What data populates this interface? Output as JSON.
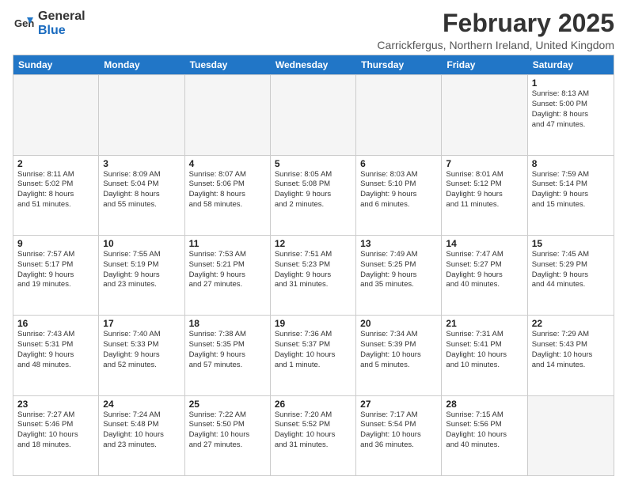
{
  "logo": {
    "general": "General",
    "blue": "Blue"
  },
  "title": "February 2025",
  "location": "Carrickfergus, Northern Ireland, United Kingdom",
  "days": [
    "Sunday",
    "Monday",
    "Tuesday",
    "Wednesday",
    "Thursday",
    "Friday",
    "Saturday"
  ],
  "weeks": [
    [
      {
        "num": "",
        "info": "",
        "empty": true
      },
      {
        "num": "",
        "info": "",
        "empty": true
      },
      {
        "num": "",
        "info": "",
        "empty": true
      },
      {
        "num": "",
        "info": "",
        "empty": true
      },
      {
        "num": "",
        "info": "",
        "empty": true
      },
      {
        "num": "",
        "info": "",
        "empty": true
      },
      {
        "num": "1",
        "info": "Sunrise: 8:13 AM\nSunset: 5:00 PM\nDaylight: 8 hours\nand 47 minutes.",
        "empty": false
      }
    ],
    [
      {
        "num": "2",
        "info": "Sunrise: 8:11 AM\nSunset: 5:02 PM\nDaylight: 8 hours\nand 51 minutes.",
        "empty": false
      },
      {
        "num": "3",
        "info": "Sunrise: 8:09 AM\nSunset: 5:04 PM\nDaylight: 8 hours\nand 55 minutes.",
        "empty": false
      },
      {
        "num": "4",
        "info": "Sunrise: 8:07 AM\nSunset: 5:06 PM\nDaylight: 8 hours\nand 58 minutes.",
        "empty": false
      },
      {
        "num": "5",
        "info": "Sunrise: 8:05 AM\nSunset: 5:08 PM\nDaylight: 9 hours\nand 2 minutes.",
        "empty": false
      },
      {
        "num": "6",
        "info": "Sunrise: 8:03 AM\nSunset: 5:10 PM\nDaylight: 9 hours\nand 6 minutes.",
        "empty": false
      },
      {
        "num": "7",
        "info": "Sunrise: 8:01 AM\nSunset: 5:12 PM\nDaylight: 9 hours\nand 11 minutes.",
        "empty": false
      },
      {
        "num": "8",
        "info": "Sunrise: 7:59 AM\nSunset: 5:14 PM\nDaylight: 9 hours\nand 15 minutes.",
        "empty": false
      }
    ],
    [
      {
        "num": "9",
        "info": "Sunrise: 7:57 AM\nSunset: 5:17 PM\nDaylight: 9 hours\nand 19 minutes.",
        "empty": false
      },
      {
        "num": "10",
        "info": "Sunrise: 7:55 AM\nSunset: 5:19 PM\nDaylight: 9 hours\nand 23 minutes.",
        "empty": false
      },
      {
        "num": "11",
        "info": "Sunrise: 7:53 AM\nSunset: 5:21 PM\nDaylight: 9 hours\nand 27 minutes.",
        "empty": false
      },
      {
        "num": "12",
        "info": "Sunrise: 7:51 AM\nSunset: 5:23 PM\nDaylight: 9 hours\nand 31 minutes.",
        "empty": false
      },
      {
        "num": "13",
        "info": "Sunrise: 7:49 AM\nSunset: 5:25 PM\nDaylight: 9 hours\nand 35 minutes.",
        "empty": false
      },
      {
        "num": "14",
        "info": "Sunrise: 7:47 AM\nSunset: 5:27 PM\nDaylight: 9 hours\nand 40 minutes.",
        "empty": false
      },
      {
        "num": "15",
        "info": "Sunrise: 7:45 AM\nSunset: 5:29 PM\nDaylight: 9 hours\nand 44 minutes.",
        "empty": false
      }
    ],
    [
      {
        "num": "16",
        "info": "Sunrise: 7:43 AM\nSunset: 5:31 PM\nDaylight: 9 hours\nand 48 minutes.",
        "empty": false
      },
      {
        "num": "17",
        "info": "Sunrise: 7:40 AM\nSunset: 5:33 PM\nDaylight: 9 hours\nand 52 minutes.",
        "empty": false
      },
      {
        "num": "18",
        "info": "Sunrise: 7:38 AM\nSunset: 5:35 PM\nDaylight: 9 hours\nand 57 minutes.",
        "empty": false
      },
      {
        "num": "19",
        "info": "Sunrise: 7:36 AM\nSunset: 5:37 PM\nDaylight: 10 hours\nand 1 minute.",
        "empty": false
      },
      {
        "num": "20",
        "info": "Sunrise: 7:34 AM\nSunset: 5:39 PM\nDaylight: 10 hours\nand 5 minutes.",
        "empty": false
      },
      {
        "num": "21",
        "info": "Sunrise: 7:31 AM\nSunset: 5:41 PM\nDaylight: 10 hours\nand 10 minutes.",
        "empty": false
      },
      {
        "num": "22",
        "info": "Sunrise: 7:29 AM\nSunset: 5:43 PM\nDaylight: 10 hours\nand 14 minutes.",
        "empty": false
      }
    ],
    [
      {
        "num": "23",
        "info": "Sunrise: 7:27 AM\nSunset: 5:46 PM\nDaylight: 10 hours\nand 18 minutes.",
        "empty": false
      },
      {
        "num": "24",
        "info": "Sunrise: 7:24 AM\nSunset: 5:48 PM\nDaylight: 10 hours\nand 23 minutes.",
        "empty": false
      },
      {
        "num": "25",
        "info": "Sunrise: 7:22 AM\nSunset: 5:50 PM\nDaylight: 10 hours\nand 27 minutes.",
        "empty": false
      },
      {
        "num": "26",
        "info": "Sunrise: 7:20 AM\nSunset: 5:52 PM\nDaylight: 10 hours\nand 31 minutes.",
        "empty": false
      },
      {
        "num": "27",
        "info": "Sunrise: 7:17 AM\nSunset: 5:54 PM\nDaylight: 10 hours\nand 36 minutes.",
        "empty": false
      },
      {
        "num": "28",
        "info": "Sunrise: 7:15 AM\nSunset: 5:56 PM\nDaylight: 10 hours\nand 40 minutes.",
        "empty": false
      },
      {
        "num": "",
        "info": "",
        "empty": true
      }
    ]
  ]
}
